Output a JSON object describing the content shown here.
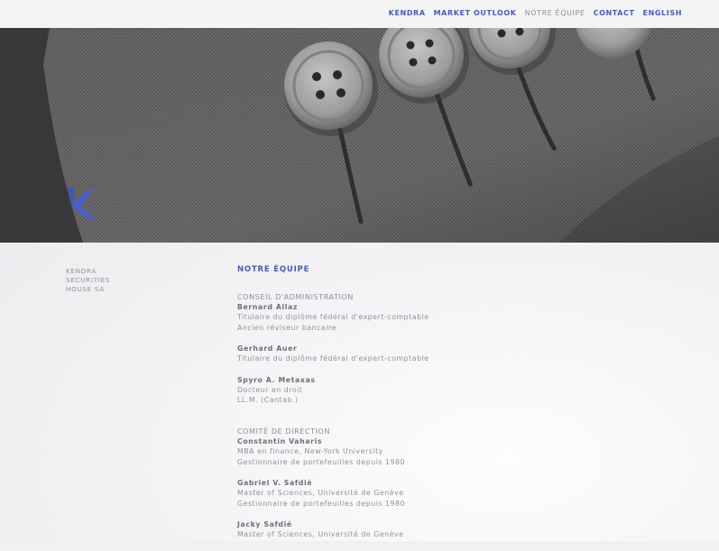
{
  "nav": {
    "items": [
      {
        "label": "KENDRA",
        "active": false
      },
      {
        "label": "MARKET OUTLOOK",
        "active": false
      },
      {
        "label": "NOTRE ÉQUIPE",
        "active": true
      },
      {
        "label": "CONTACT",
        "active": false
      },
      {
        "label": "ENGLISH",
        "active": false
      }
    ]
  },
  "colors": {
    "accent": "#4a5bb0",
    "muted_text": "#8f919b"
  },
  "sidebar": {
    "company_lines": [
      "KENDRA",
      "SECURITIES",
      "HOUSE SA"
    ]
  },
  "main": {
    "title": "NOTRE ÉQUIPE",
    "sections": [
      {
        "title": "CONSEIL D'ADMINISTRATION",
        "members": [
          {
            "name": "Bernard Allaz",
            "lines": [
              "Titulaire du diplôme fédéral d'expert-comptable",
              "Ancien réviseur bancaire"
            ]
          },
          {
            "name": "Gerhard Auer",
            "lines": [
              "Titulaire du diplôme fédéral d'expert-comptable"
            ]
          },
          {
            "name": "Spyro A. Metaxas",
            "lines": [
              "Docteur en droit",
              "LL.M. (Cantab.)"
            ]
          }
        ]
      },
      {
        "title": "COMITÉ DE DIRECTION",
        "members": [
          {
            "name": "Constantin Vaharis",
            "lines": [
              "MBA en finance, New-York University",
              "Gestionnaire de portefeuilles depuis 1980"
            ]
          },
          {
            "name": "Gabriel V. Safdié",
            "lines": [
              "Master of Sciences, Université de Genève",
              "Gestionnaire de portefeuilles depuis 1980"
            ]
          },
          {
            "name": "Jacky Safdié",
            "lines": [
              "Master of Sciences, Université de Genève"
            ]
          }
        ]
      }
    ]
  }
}
